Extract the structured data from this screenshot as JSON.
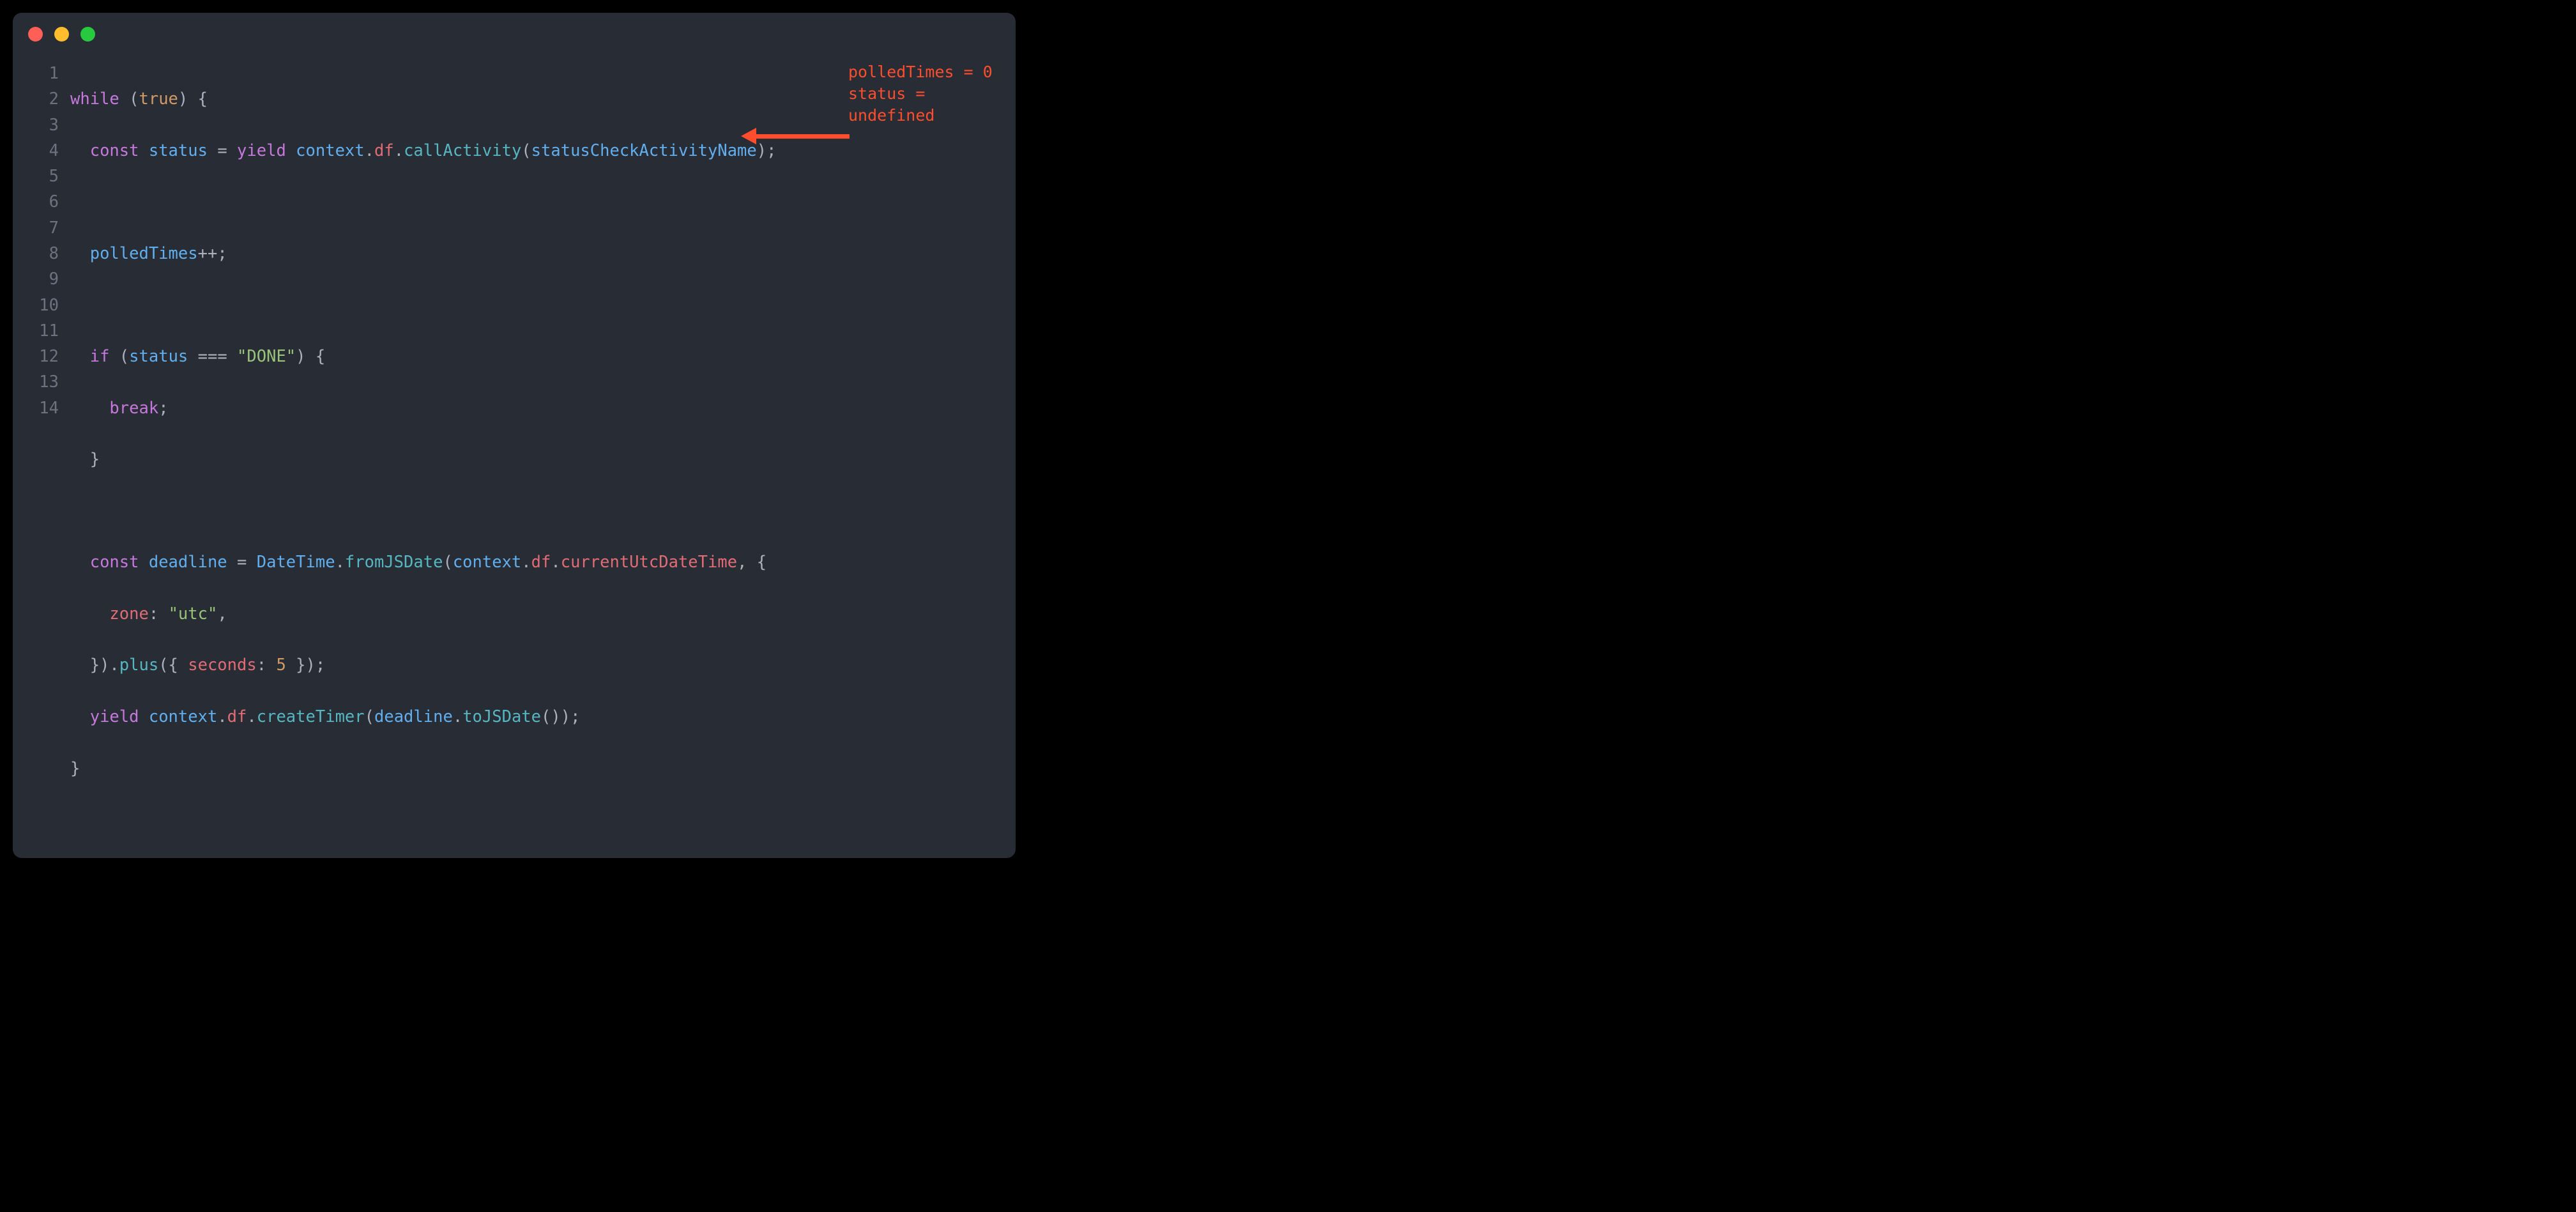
{
  "gutter": [
    "1",
    "2",
    "3",
    "4",
    "5",
    "6",
    "7",
    "8",
    "9",
    "10",
    "11",
    "12",
    "13",
    "14"
  ],
  "code": {
    "l1": {
      "while": "while",
      "true": "true"
    },
    "l2": {
      "const": "const",
      "status": "status",
      "yield": "yield",
      "context": "context",
      "df": "df",
      "callActivity": "callActivity",
      "arg": "statusCheckActivityName"
    },
    "l4": {
      "polledTimes": "polledTimes"
    },
    "l6": {
      "if": "if",
      "status": "status",
      "done": "\"DONE\""
    },
    "l7": {
      "break": "break"
    },
    "l10": {
      "const": "const",
      "deadline": "deadline",
      "DateTime": "DateTime",
      "fromJSDate": "fromJSDate",
      "context": "context",
      "df": "df",
      "currentUtcDateTime": "currentUtcDateTime"
    },
    "l11": {
      "zone": "zone",
      "utc": "\"utc\""
    },
    "l12": {
      "plus": "plus",
      "seconds": "seconds",
      "five": "5"
    },
    "l13": {
      "yield": "yield",
      "context": "context",
      "df": "df",
      "createTimer": "createTimer",
      "deadline": "deadline",
      "toJSDate": "toJSDate"
    }
  },
  "annotation": {
    "line1": "polledTimes = 0",
    "line2": "status = undefined"
  }
}
